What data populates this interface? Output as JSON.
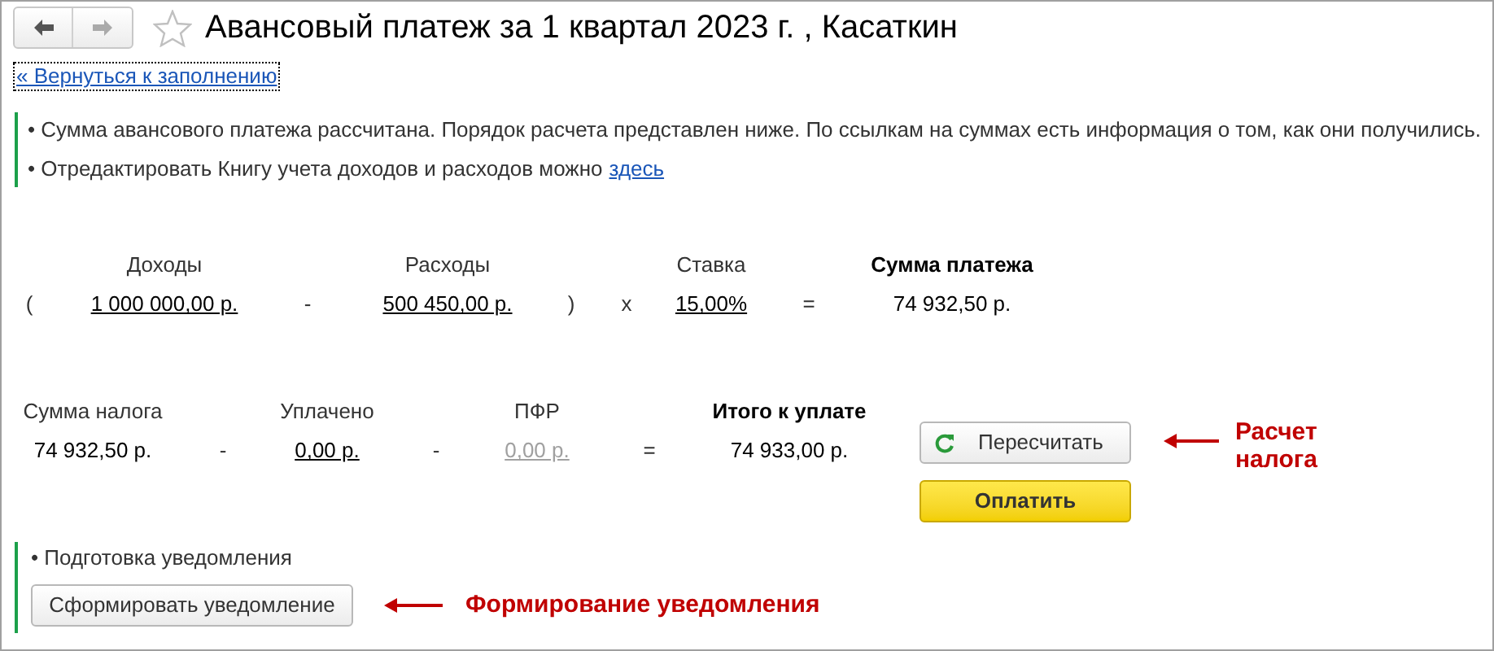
{
  "window": {
    "title": "Авансовый платеж за 1 квартал 2023 г. , Касаткин",
    "favorite": false
  },
  "back_link": "« Вернуться к заполнению",
  "info": [
    {
      "text": "• Сумма авансового платежа рассчитана. Порядок расчета представлен ниже. По ссылкам на суммах есть информация о том, как они получились."
    },
    {
      "text": "• Отредактировать Книгу учета доходов и расходов можно",
      "link": "здесь"
    }
  ],
  "payment_formula": [
    {
      "kind": "operator",
      "value": "("
    },
    {
      "kind": "link",
      "header": "Доходы",
      "value": "1 000 000,00 р.",
      "disabled": false
    },
    {
      "kind": "operator",
      "value": "-"
    },
    {
      "kind": "link",
      "header": "Расходы",
      "value": "500 450,00 р.",
      "disabled": false
    },
    {
      "kind": "operator",
      "value": ")"
    },
    {
      "kind": "operator",
      "value": "x"
    },
    {
      "kind": "link",
      "header": "Ставка",
      "value": "15,00%",
      "disabled": false
    },
    {
      "kind": "operator",
      "value": "="
    },
    {
      "kind": "result",
      "header": "Сумма платежа",
      "value": "74 932,50 р."
    }
  ],
  "tax_formula": [
    {
      "kind": "text",
      "header": "Сумма налога",
      "value": "74 932,50 р."
    },
    {
      "kind": "operator",
      "value": "-"
    },
    {
      "kind": "link",
      "header": "Уплачено",
      "value": "0,00 р.",
      "disabled": false
    },
    {
      "kind": "operator",
      "value": "-"
    },
    {
      "kind": "link",
      "header": "ПФР",
      "value": "0,00 р.",
      "disabled": true
    },
    {
      "kind": "operator",
      "value": "="
    },
    {
      "kind": "result",
      "header": "Итого к уплате",
      "value": "74 933,00 р."
    }
  ],
  "buttons": [
    {
      "label": "Пересчитать",
      "kind": "refresh"
    },
    {
      "label": "Оплатить",
      "kind": "primary"
    }
  ],
  "tax_annotation": "Расчет налога",
  "notice": {
    "text": "• Подготовка уведомления",
    "button": "Сформировать уведомление",
    "annotation": "Формирование уведомления"
  }
}
